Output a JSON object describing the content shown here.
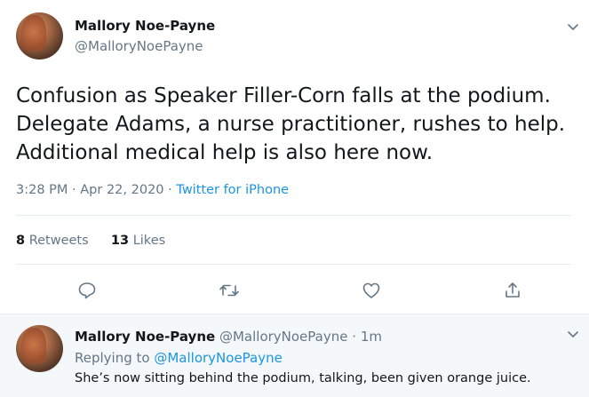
{
  "tweet": {
    "author_name": "Mallory Noe-Payne",
    "author_handle": "@MalloryNoePayne",
    "text_lines": [
      "Confusion as Speaker Filler-Corn falls at the podium.",
      "Delegate Adams, a nurse practitioner, rushes to help.",
      "Additional medical help is also here now."
    ],
    "time": "3:28 PM",
    "separator": "·",
    "date": "Apr 22, 2020",
    "source": "Twitter for iPhone",
    "retweets_count": "8",
    "retweets_label": "Retweets",
    "likes_count": "13",
    "likes_label": "Likes",
    "icons": [
      "reply-icon",
      "retweet-icon",
      "like-icon",
      "share-icon",
      "chevron-down-icon"
    ]
  },
  "reply": {
    "author_name": "Mallory Noe-Payne",
    "author_handle": "@MalloryNoePayne",
    "separator": "·",
    "age": "1m",
    "replying_to_label": "Replying to",
    "replying_to_handle": "@MalloryNoePayne",
    "text": "She’s now sitting behind the podium, talking, been given orange juice."
  },
  "colors": {
    "link": "#1b95e0",
    "secondary_text": "#657786",
    "primary_text": "#14171a",
    "divider": "#e6ecf0",
    "reply_background": "#f5f8fa"
  }
}
